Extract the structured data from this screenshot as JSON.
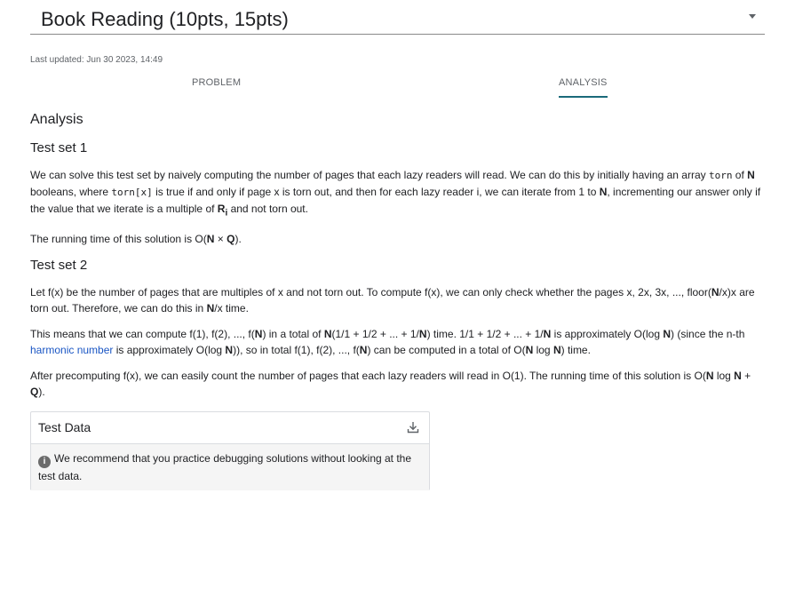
{
  "header": {
    "title": "Book Reading (10pts, 15pts)"
  },
  "last_updated": "Last updated: Jun 30 2023, 14:49",
  "tabs": {
    "problem": "PROBLEM",
    "analysis": "ANALYSIS"
  },
  "content": {
    "heading": "Analysis",
    "ts1": {
      "title": "Test set 1",
      "p1": {
        "a": "We can solve this test set by naively computing the number of pages that each lazy readers will read. We can do this by initially having an array ",
        "code1": "torn",
        "b": " of ",
        "n1": "N",
        "c": " booleans, where ",
        "code2": "torn[x]",
        "d": " is true if and only if page x is torn out, and then for each lazy reader i, we can iterate from 1 to ",
        "n2": "N",
        "e": ", incrementing our answer only if the value that we iterate is a multiple of ",
        "r": "R",
        "ri": "i",
        "f": " and not torn out."
      },
      "p2": {
        "a": "The running time of this solution is O(",
        "n": "N",
        "x": " × ",
        "q": "Q",
        "b": ")."
      }
    },
    "ts2": {
      "title": "Test set 2",
      "p1": {
        "a": "Let f(x) be the number of pages that are multiples of x and not torn out. To compute f(x), we can only check whether the pages x, 2x, 3x, ..., floor(",
        "n1": "N",
        "b": "/x)x are torn out. Therefore, we can do this in ",
        "n2": "N",
        "c": "/x time."
      },
      "p2": {
        "a": "This means that we can compute f(1), f(2), ..., f(",
        "n1": "N",
        "b": ") in a total of ",
        "n2": "N",
        "c": "(1/1 + 1/2 + ... + 1/",
        "n3": "N",
        "d": ") time. 1/1 + 1/2 + ... + 1/",
        "n4": "N",
        "e": " is approximately O(log ",
        "n5": "N",
        "f": ") (since the n-th ",
        "link": "harmonic number",
        "g": " is approximately O(log ",
        "n6": "N",
        "h": ")), so in total f(1), f(2), ..., f(",
        "n7": "N",
        "i": ") can be computed in a total of O(",
        "n8": "N",
        "j": " log ",
        "n9": "N",
        "k": ") time."
      },
      "p3": {
        "a": "After precomputing f(x), we can easily count the number of pages that each lazy readers will read in O(1). The running time of this solution is O(",
        "n1": "N",
        "b": " log ",
        "n2": "N",
        "c": " + ",
        "q": "Q",
        "d": ")."
      }
    }
  },
  "test_data": {
    "title": "Test Data",
    "notice": "We recommend that you practice debugging solutions without looking at the test data.",
    "info_glyph": "i"
  },
  "icons": {
    "dropdown": "caret-down-icon",
    "download": "download-icon",
    "info": "info-icon"
  }
}
